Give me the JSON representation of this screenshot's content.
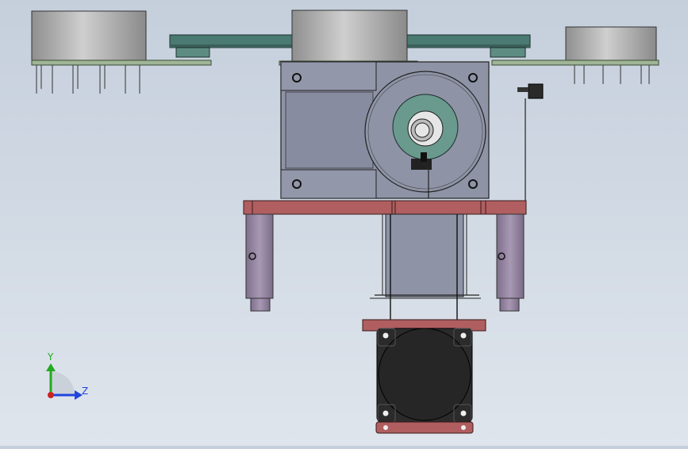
{
  "view": {
    "background_top": "#c5cfdc",
    "background_bottom": "#dfe5ec"
  },
  "triad": {
    "y_label": "Y",
    "z_label": "Z",
    "y_color": "#22aa22",
    "z_color": "#2244dd",
    "x_color": "#cc2222"
  },
  "colors": {
    "sensor_body": "#a8a8a8",
    "pcb": "#9fb596",
    "rail": "#4a7a72",
    "motor_body": "#8e93a6",
    "plate": "#b05e60",
    "post": "#9a8aa6",
    "fan_body": "#2b2b2b",
    "gear_teal": "#6a9a8e"
  }
}
